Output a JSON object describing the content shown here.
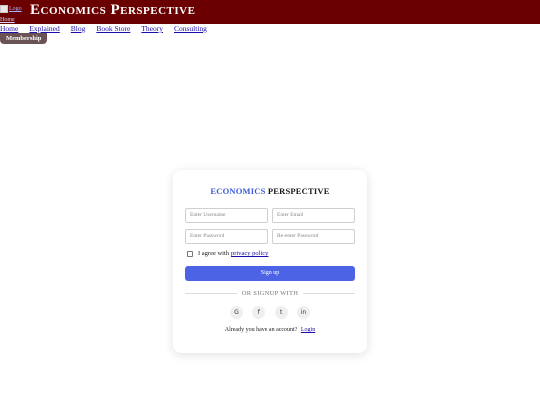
{
  "header": {
    "logo_alt": "Logo",
    "brand": "Economics Perspective",
    "home_link": "Home",
    "bg_color": "#6b0000"
  },
  "nav": {
    "items": [
      "Home",
      "Explained",
      "Blog",
      "Book Store",
      "Theory",
      "Consulting"
    ],
    "membership": "Membership"
  },
  "signup": {
    "title_part1": "ECONOMICS",
    "title_part2": "PERSPECTIVE",
    "username_placeholder": "Enter Username",
    "email_placeholder": "Enter Email",
    "password_placeholder": "Enter Password",
    "repassword_placeholder": "Re-enter Password",
    "agree_text": "I agree with",
    "privacy_link": "privacy policy",
    "signup_button": "Sign up",
    "divider_text": "OR SIGNUP WITH",
    "socials": [
      {
        "icon": "google-icon",
        "glyph": "G"
      },
      {
        "icon": "facebook-icon",
        "glyph": "f"
      },
      {
        "icon": "twitter-icon",
        "glyph": "t"
      },
      {
        "icon": "linkedin-icon",
        "glyph": "in"
      }
    ],
    "have_account": "Already you have an account?",
    "login_link": "Login",
    "accent_color": "#4c63e6"
  }
}
